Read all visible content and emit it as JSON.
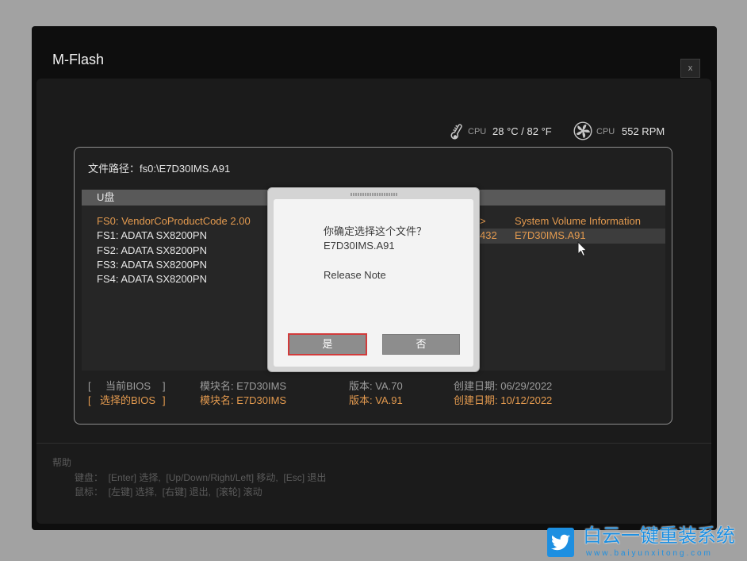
{
  "window": {
    "title": "M-Flash",
    "close_label": "x"
  },
  "status": {
    "temperature": {
      "icon": "thermometer-icon",
      "label": "CPU",
      "value": "28 °C / 82 °F"
    },
    "fan": {
      "icon": "fan-icon",
      "label": "CPU",
      "value": "552 RPM"
    }
  },
  "file_path": "文件路径：fs0:\\E7D30IMS.A91",
  "drives": {
    "header": "U盘",
    "items": [
      {
        "label": "FS0: VendorCoProductCode 2.00",
        "selected": true
      },
      {
        "label": "FS1: ADATA SX8200PN",
        "selected": false
      },
      {
        "label": "FS2: ADATA SX8200PN",
        "selected": false
      },
      {
        "label": "FS3: ADATA SX8200PN",
        "selected": false
      },
      {
        "label": "FS4: ADATA SX8200PN",
        "selected": false
      }
    ]
  },
  "files": {
    "items": [
      {
        "info": ">",
        "name": "System Volume Information",
        "highlighted": false
      },
      {
        "info": "432",
        "name": "E7D30IMS.A91",
        "highlighted": true
      }
    ]
  },
  "bios": {
    "bracket_open": "[",
    "bracket_close": "]",
    "current": {
      "label": "当前BIOS",
      "module": "模块名: E7D30IMS",
      "version": "版本: VA.70",
      "date": "创建日期: 06/29/2022"
    },
    "selected": {
      "label": "选择的BIOS",
      "module": "模块名: E7D30IMS",
      "version": "版本: VA.91",
      "date": "创建日期: 10/12/2022"
    }
  },
  "help": {
    "title": "帮助",
    "keyboard": "键盘：  [Enter] 选择,  [Up/Down/Right/Left] 移动,  [Esc] 退出",
    "mouse": "鼠标：  [左键] 选择,  [右键] 退出,  [滚轮] 滚动"
  },
  "dialog": {
    "question": "你确定选择这个文件？",
    "file_name": "E7D30IMS.A91",
    "release_note": "Release Note",
    "yes_label": "是",
    "no_label": "否",
    "yes_focused": true
  },
  "watermark": {
    "icon": "bird-icon",
    "brand": "白云一键重装系统",
    "url": "www.baiyunxitong.com"
  },
  "colors": {
    "accent_orange": "#e39a4f",
    "text_white": "#e6e6e6",
    "focus_red": "#d23b3b",
    "watermark_blue": "#1d8fe1"
  }
}
